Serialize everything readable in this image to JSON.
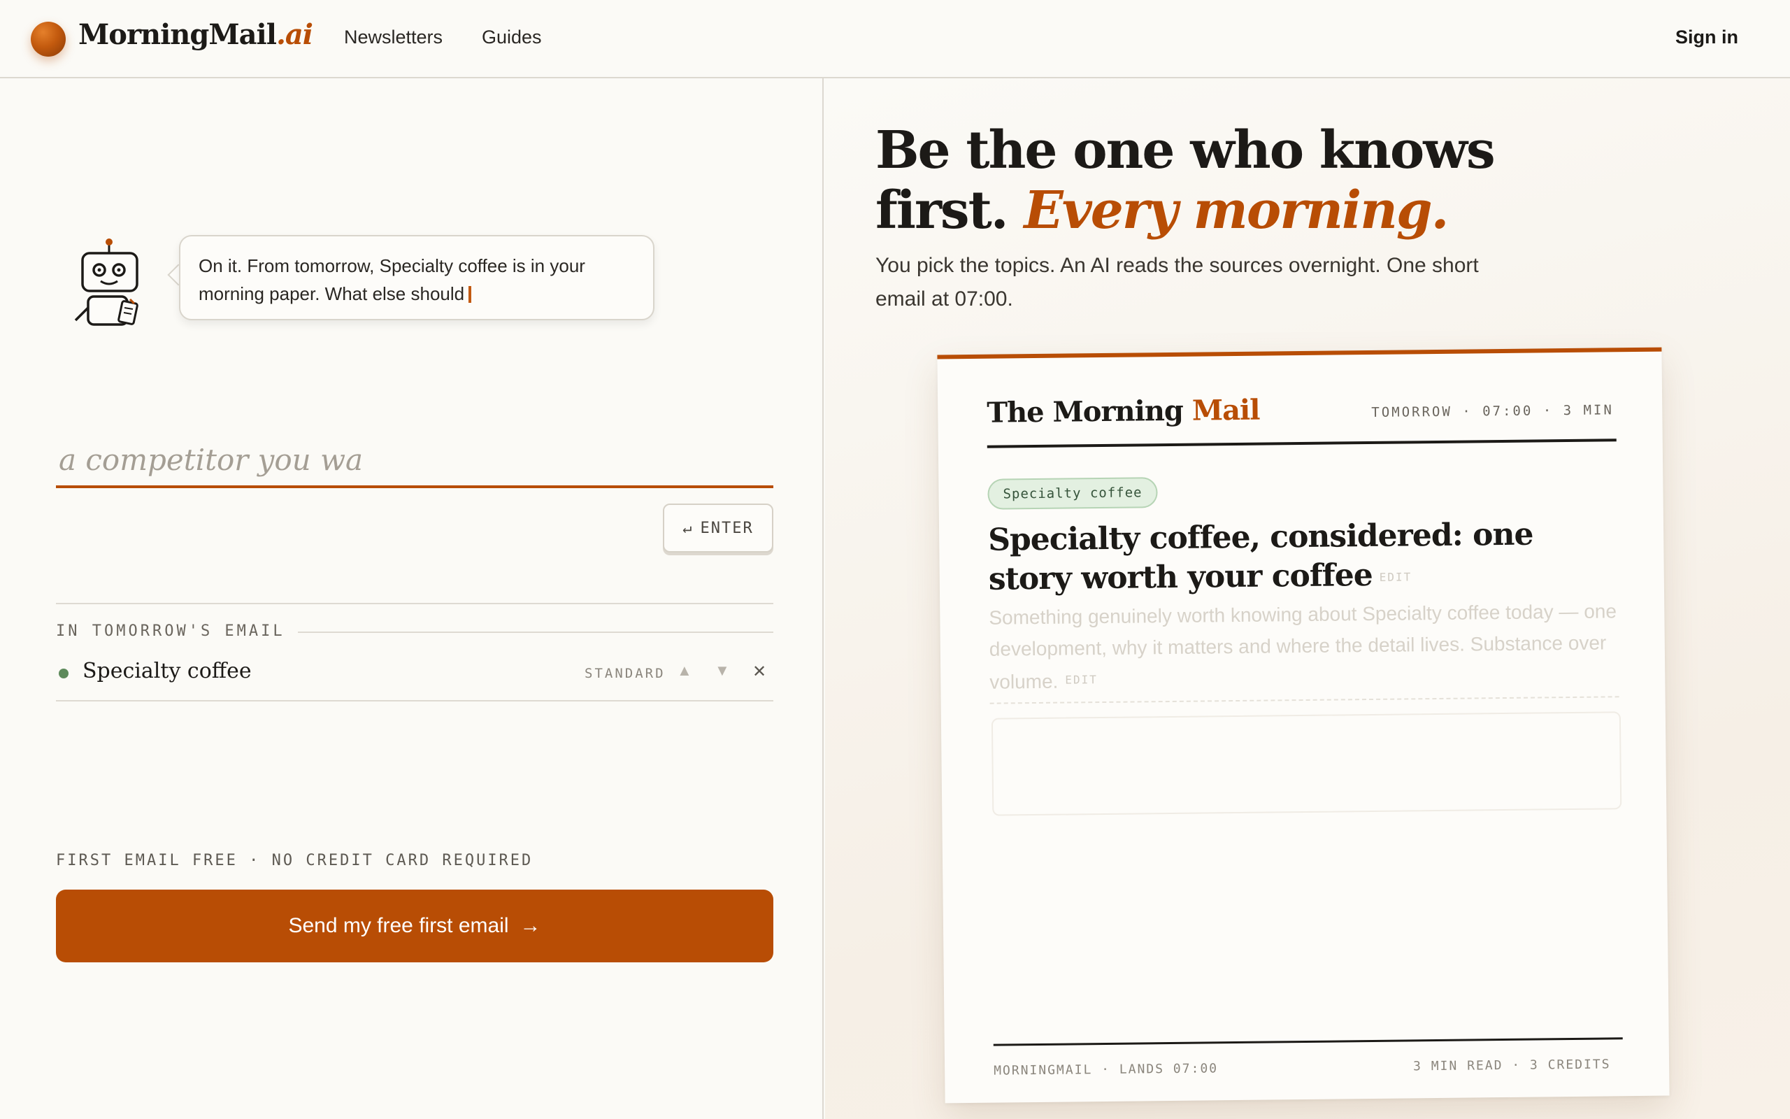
{
  "header": {
    "brand_main": "MorningMail",
    "brand_suffix": ".ai",
    "nav": [
      "Newsletters",
      "Guides"
    ],
    "signin": "Sign in"
  },
  "assistant": {
    "message": "On it. From tomorrow, Specialty coffee is in your morning paper. What else should"
  },
  "topic_input": {
    "value": "a competitor you wa",
    "enter_label": "ENTER",
    "enter_icon": "↵"
  },
  "tomorrow": {
    "label": "IN TOMORROW'S EMAIL",
    "items": [
      {
        "name": "Specialty coffee",
        "tier": "STANDARD"
      }
    ]
  },
  "signup": {
    "note": "FIRST EMAIL FREE · NO CREDIT CARD REQUIRED",
    "cta": "Send my free first email",
    "cta_icon": "→"
  },
  "hero": {
    "title_line1": "Be the one who knows",
    "title_line2_plain": "first.",
    "title_line2_accent": "Every morning.",
    "subtitle": "You pick the topics. An AI reads the sources overnight. One short email at 07:00."
  },
  "preview": {
    "title_plain": "The Morning",
    "title_accent": "Mail",
    "meta": "TOMORROW · 07:00 · 3 MIN",
    "chip": "Specialty coffee",
    "headline": "Specialty coffee, considered: one story worth your coffee",
    "edit": "EDIT",
    "summary": "Something genuinely worth knowing about Specialty coffee today — one development, why it matters and where the detail lives. Substance over volume.",
    "footer_left": "MORNINGMAIL · LANDS 07:00",
    "footer_right": "3 MIN READ · 3 CREDITS"
  },
  "colors": {
    "accent": "#b84d05",
    "background": "#fbfaf6",
    "topic_dot": "#5d8a5b",
    "chip_bg": "#e3f0e1"
  }
}
